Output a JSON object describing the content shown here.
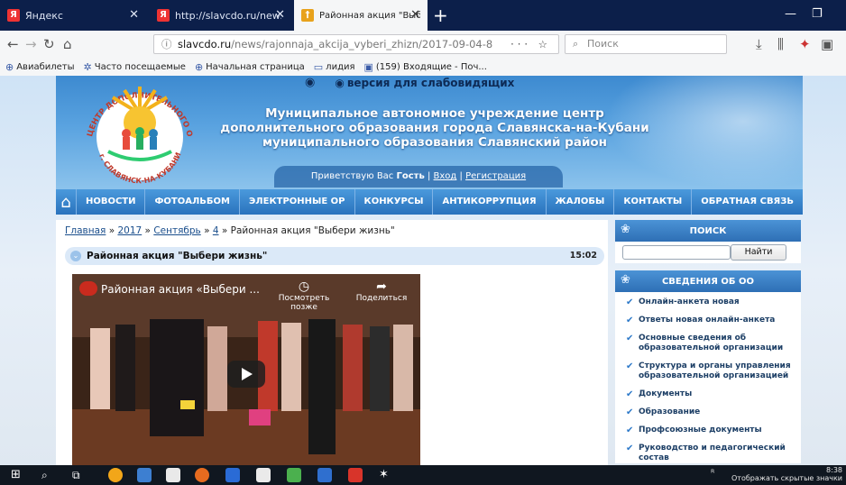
{
  "browser": {
    "tabs": [
      {
        "label": "Яндекс",
        "active": false
      },
      {
        "label": "http://slavcdo.ru/news/rajonn",
        "active": false
      },
      {
        "label": "Районная акция \"Выбери жиз",
        "active": true
      }
    ],
    "url_domain": "slavcdo.ru",
    "url_path": "/news/rajonnaja_akcija_vyberi_zhizn/2017-09-04-8",
    "search_placeholder": "Поиск",
    "bookmarks": [
      "Авиабилеты",
      "Часто посещаемые",
      "Начальная страница",
      "лидия",
      "(159) Входящие - Поч..."
    ]
  },
  "site": {
    "accessibility_link": "версия для слабовидящих",
    "org_name_line1": "Муниципальное автономное учреждение центр",
    "org_name_line2": "дополнительного образования города Славянска-на-Кубани",
    "org_name_line3": "муниципального образования Славянский район",
    "greeting_prefix": "Приветствую Вас",
    "greeting_user": "Гость",
    "login_link": "Вход",
    "register_link": "Регистрация",
    "logo_top_text": "ЦЕНТР ДОПОЛНИТЕЛЬНОГО ОБРАЗОВАНИЯ",
    "logo_bottom_text": "г. СЛАВЯНСК-НА-КУБАНИ",
    "menu": [
      "НОВОСТИ",
      "ФОТОАЛЬБОМ",
      "ЭЛЕКТРОННЫЕ ОР",
      "КОНКУРСЫ",
      "АНТИКОРРУПЦИЯ",
      "ЖАЛОБЫ",
      "КОНТАКТЫ",
      "ОБРАТНАЯ СВЯЗЬ"
    ]
  },
  "article": {
    "crumb_home": "Главная",
    "crumb_year": "2017",
    "crumb_month": "Сентябрь",
    "crumb_day": "4",
    "crumb_current": "Районная акция \"Выбери жизнь\"",
    "title": "Районная акция \"Выбери жизнь\"",
    "time": "15:02",
    "video_title": "Районная акция «Выбери ...",
    "watch_later": "Посмотреть позже",
    "share": "Поделиться"
  },
  "sidebar": {
    "search_title": "ПОИСК",
    "search_button": "Найти",
    "info_title": "СВЕДЕНИЯ ОБ ОО",
    "items": [
      "Онлайн-анкета новая",
      "Ответы новая онлайн-анкета",
      "Основные сведения об образовательной организации",
      "Структура и органы управления образовательной организацией",
      "Документы",
      "Образование",
      "Профсоюзные документы",
      "Руководство и педагогический состав"
    ]
  },
  "taskbar": {
    "time": "8:38",
    "tray_hint": "Отображать скрытые значки"
  }
}
